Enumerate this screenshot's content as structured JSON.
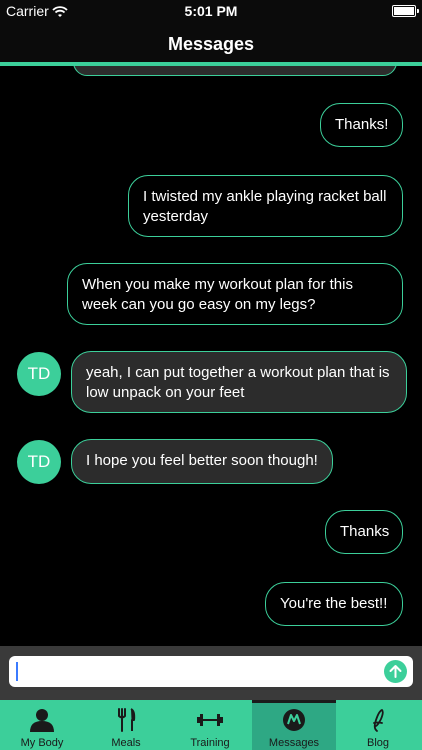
{
  "status": {
    "carrier": "Carrier",
    "time": "5:01 PM"
  },
  "header": {
    "title": "Messages"
  },
  "messages": [
    {
      "text": "Thanks!",
      "side": "out"
    },
    {
      "text": "I twisted my ankle playing racket ball yesterday",
      "side": "out"
    },
    {
      "text": "When you make my workout plan for this week can you go easy on my legs?",
      "side": "out"
    },
    {
      "text": "yeah, I can put together a workout plan that is low unpack on your feet",
      "side": "in",
      "avatar": "TD"
    },
    {
      "text": "I hope you feel better soon though!",
      "side": "in",
      "avatar": "TD"
    },
    {
      "text": "Thanks",
      "side": "out"
    },
    {
      "text": "You're the best!!",
      "side": "out"
    }
  ],
  "composer": {
    "value": ""
  },
  "tabs": [
    {
      "label": "My Body",
      "icon": "person-icon"
    },
    {
      "label": "Meals",
      "icon": "fork-knife-icon"
    },
    {
      "label": "Training",
      "icon": "dumbbell-icon"
    },
    {
      "label": "Messages",
      "icon": "messages-icon",
      "active": true
    },
    {
      "label": "Blog",
      "icon": "blog-icon"
    }
  ],
  "colors": {
    "accent": "#3ccf9a",
    "bubble_in": "#2c2c2c",
    "background": "#000000"
  }
}
